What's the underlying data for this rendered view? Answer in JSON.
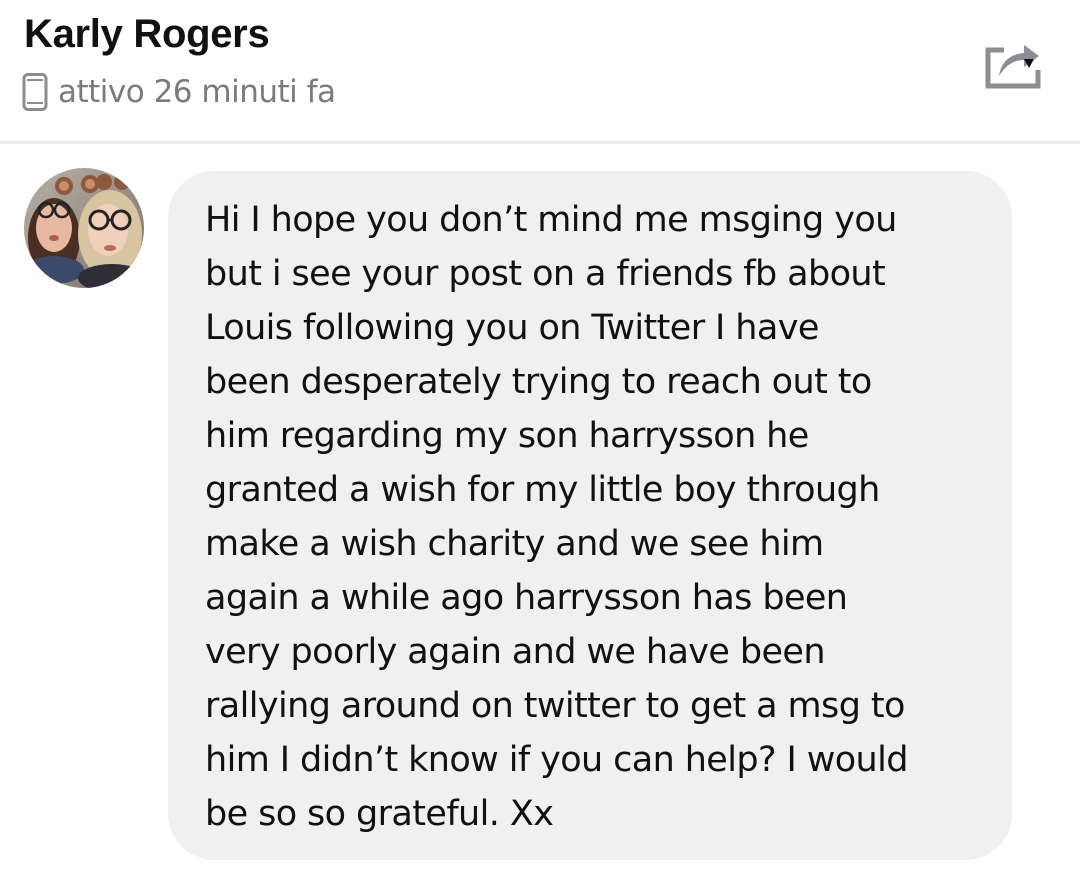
{
  "header": {
    "contact_name": "Karly Rogers",
    "status_icon": "phone-icon",
    "status_text": "attivo 26 minuti fa",
    "share_icon": "share-icon"
  },
  "conversation": {
    "avatar_icon": "avatar",
    "messages": [
      {
        "sender": "Karly Rogers",
        "text": "Hi I hope you don’t mind me msging you\nbut i see your post on a friends fb about\nLouis following you on Twitter I have\nbeen desperately trying to reach out to\nhim regarding my son harrysson he\ngranted a wish for my little boy through\nmake a wish charity and we see him\nagain a while ago harrysson has been\nvery poorly again and we have been\nrallying around on twitter to get a msg to\nhim I didn’t know if you can help? I would\nbe so so grateful. Xx"
      }
    ]
  },
  "colors": {
    "bubble_background": "#f0f0f0",
    "status_text": "#7b7b7b",
    "divider": "#e9eaec",
    "icon_gray": "#8a8d91"
  }
}
